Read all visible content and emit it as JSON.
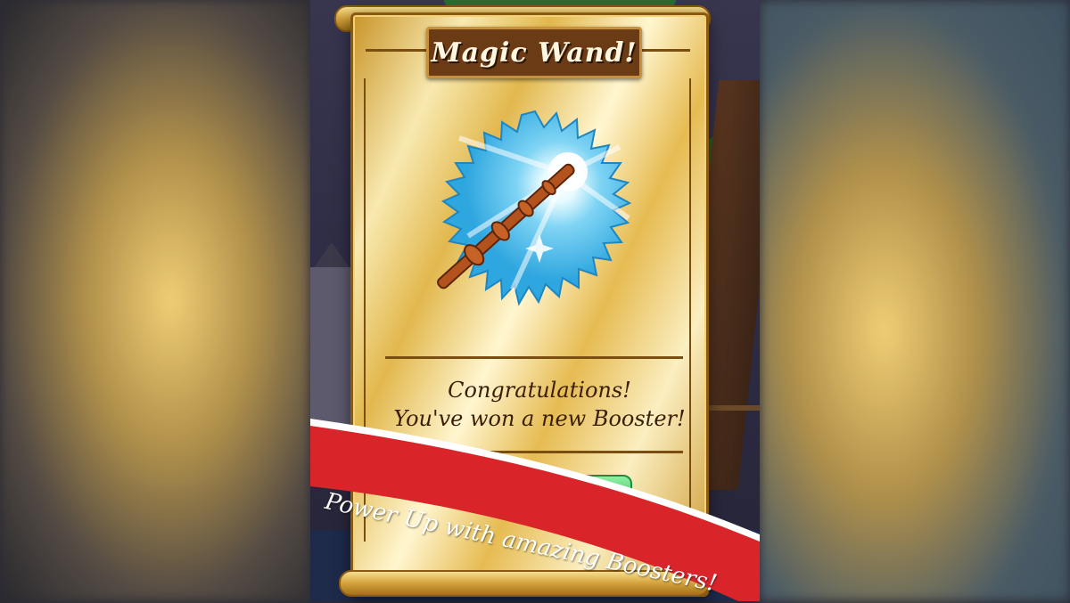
{
  "popup": {
    "title": "Magic Wand!",
    "reward_icon": "magic-wand-icon",
    "message_line1": "Congratulations!",
    "message_line2": "You've won a new Booster!"
  },
  "banner": {
    "text": "Power Up with amazing Boosters!",
    "color": "#d9242a"
  },
  "colors": {
    "badge": "#3fb7e8",
    "scroll_gold": "#e2b84e",
    "title_plate": "#6b3b15",
    "button_green": "#2fbf5a"
  }
}
